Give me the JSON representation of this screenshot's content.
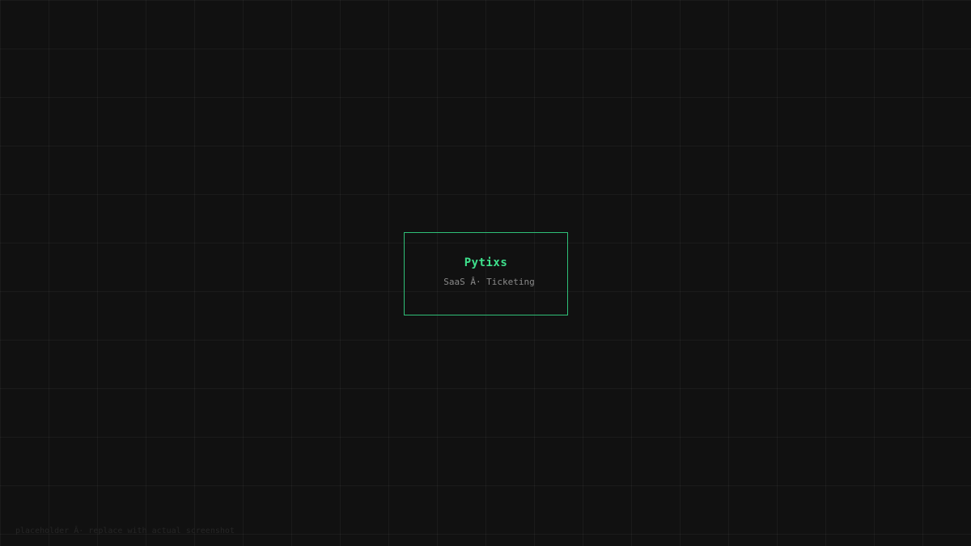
{
  "card": {
    "title": "Pytixs",
    "subtitle": "SaaS Â· Ticketing"
  },
  "footer": {
    "note": "placeholder Â· replace with actual screenshot"
  },
  "colors": {
    "background": "#111111",
    "accent": "#3ee08c",
    "border": "#2fbf77",
    "subtitle": "#8a8a8a"
  }
}
